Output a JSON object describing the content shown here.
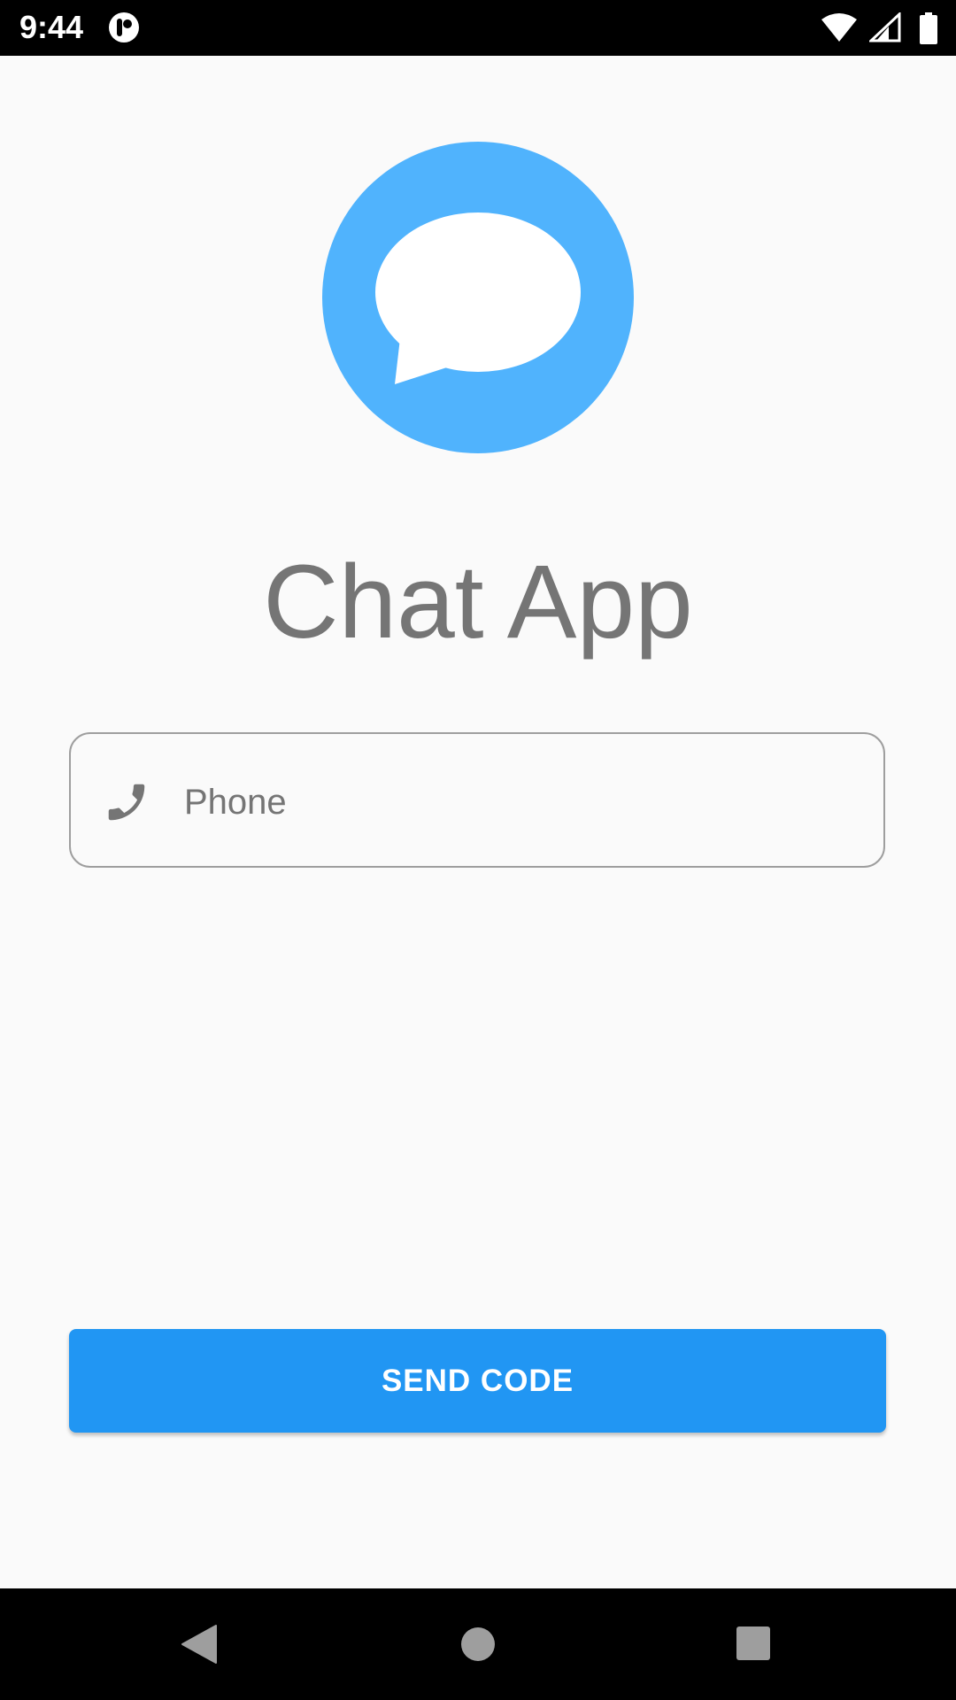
{
  "status_bar": {
    "time": "9:44",
    "app_icon": "notification-app-icon",
    "wifi_icon": "wifi-icon",
    "signal_icon": "cell-signal-icon",
    "battery_icon": "battery-icon"
  },
  "logo": {
    "icon": "chat-bubble-icon",
    "color": "#50b3fd"
  },
  "title": "Chat App",
  "phone_field": {
    "icon": "phone-icon",
    "placeholder": "Phone",
    "value": ""
  },
  "send_button": {
    "label": "SEND CODE",
    "color": "#2196f3"
  },
  "nav_bar": {
    "back_icon": "back-triangle-icon",
    "home_icon": "home-circle-icon",
    "recents_icon": "recents-square-icon"
  }
}
